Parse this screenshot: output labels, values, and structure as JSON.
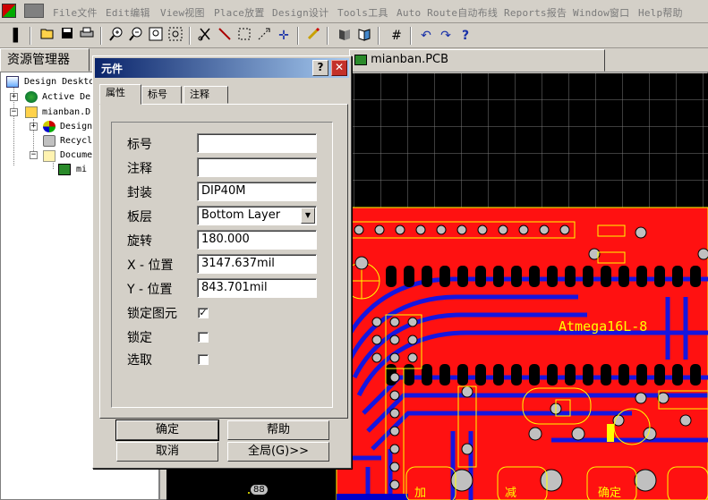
{
  "menubar": {
    "items": [
      "File文件",
      "Edit编辑",
      "View视图",
      "Place放置",
      "Design设计",
      "Tools工具",
      "Auto Route自动布线",
      "Reports报告",
      "Window窗口",
      "Help帮助"
    ]
  },
  "toolbar": {
    "icons": [
      "open-folder-icon",
      "save-icon",
      "print-icon",
      "zoom-in-icon",
      "zoom-out-icon",
      "zoom-fit-icon",
      "zoom-area-icon",
      "cut-icon",
      "draw-line-icon",
      "select-rect-icon",
      "cross-probe-icon",
      "move-icon",
      "pen-icon",
      "3d-view-icon",
      "library-icon",
      "grid-icon",
      "undo-icon",
      "redo-icon",
      "help-icon"
    ]
  },
  "explorer": {
    "tab_label": "资源管理器",
    "tree": [
      {
        "label": "Design Deskto"
      },
      {
        "label": "Active De"
      },
      {
        "label": "mianban.D"
      },
      {
        "label": "Design"
      },
      {
        "label": "Recycl"
      },
      {
        "label": "Docume"
      },
      {
        "label": "mi"
      }
    ]
  },
  "document": {
    "tab_label": "mianban.PCB",
    "silkscreen_label": "Atmega16L-8",
    "bottom_labels": [
      "加",
      "减",
      "确定",
      "88"
    ]
  },
  "dialog": {
    "title": "元件",
    "help_glyph": "?",
    "close_glyph": "✕",
    "tabs": [
      "属性",
      "标号",
      "注释"
    ],
    "fields": {
      "designator": {
        "label": "标号",
        "value": ""
      },
      "comment": {
        "label": "注释",
        "value": ""
      },
      "footprint": {
        "label": "封装",
        "value": "DIP40M"
      },
      "layer": {
        "label": "板层",
        "value": "Bottom Layer"
      },
      "rotation": {
        "label": "旋转",
        "value": "180.000"
      },
      "x": {
        "label": "X - 位置",
        "value": "3147.637mil"
      },
      "y": {
        "label": "Y - 位置",
        "value": "843.701mil"
      }
    },
    "checks": {
      "lock_prims": {
        "label": "锁定图元",
        "checked": true,
        "mark": "✓"
      },
      "locked": {
        "label": "锁定",
        "checked": false,
        "mark": ""
      },
      "selected": {
        "label": "选取",
        "checked": false,
        "mark": ""
      }
    },
    "buttons": {
      "ok": "确定",
      "help": "帮助",
      "cancel": "取消",
      "global": "全局(G)>>"
    }
  },
  "colors": {
    "pcb_red": "#ff1111",
    "pcb_blue": "#1515e0",
    "pad_grey": "#c0c0c0",
    "silk_yellow": "#ffff00",
    "title_start": "#0a246a",
    "title_end": "#a6caf0"
  }
}
